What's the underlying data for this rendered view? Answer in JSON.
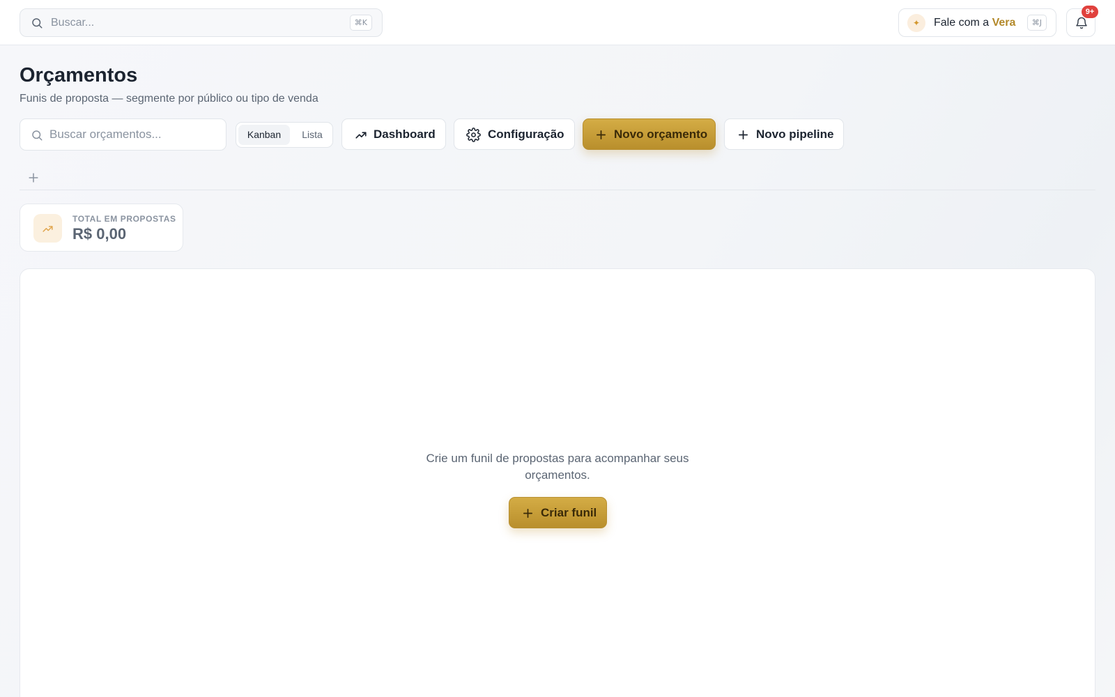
{
  "topbar": {
    "search_placeholder": "Buscar...",
    "search_shortcut": "⌘K",
    "assistant_prefix": "Fale com a ",
    "assistant_name": "Vera",
    "assistant_shortcut": "⌘J",
    "notifications_badge": "9+",
    "icons": {
      "search": "search-icon",
      "spark": "sparkle-icon",
      "bell": "bell-icon"
    }
  },
  "header": {
    "title": "Orçamentos",
    "subtitle": "Funis de proposta — segmente por público ou tipo de venda"
  },
  "toolbar": {
    "search_placeholder": "Buscar orçamentos...",
    "view_options": [
      "Kanban",
      "Lista"
    ],
    "view_selected": "Kanban",
    "dashboard_label": "Dashboard",
    "config_label": "Configuração",
    "new_quote_label": "Novo orçamento",
    "new_pipeline_label": "Novo pipeline"
  },
  "stats": {
    "total_label": "TOTAL EM PROPOSTAS",
    "total_value": "R$ 0,00"
  },
  "empty_state": {
    "message": "Crie um funil de propostas para acompanhar seus orçamentos.",
    "create_label": "Criar funil"
  },
  "colors": {
    "accent_gold": "#c49c35",
    "accent_gold_text": "#b3892a",
    "badge_red": "#e0413d"
  }
}
